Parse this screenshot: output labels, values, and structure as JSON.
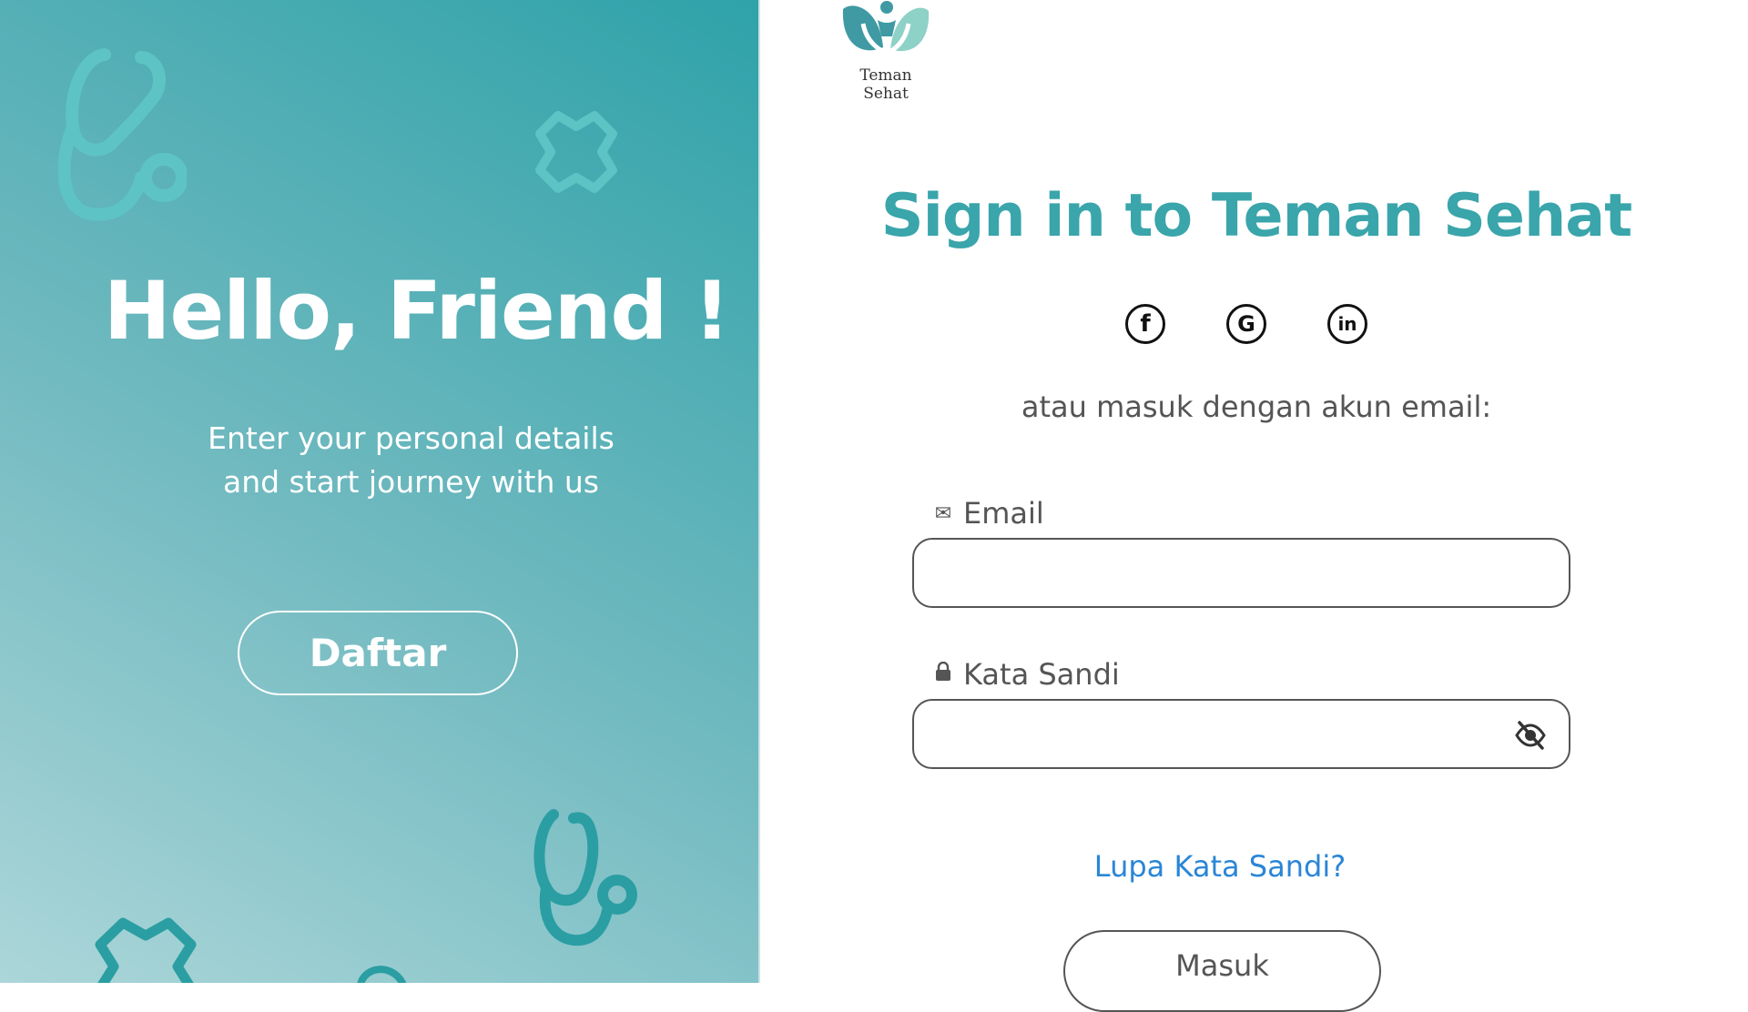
{
  "brand": {
    "name": "Teman Sehat"
  },
  "left_panel": {
    "title": "Hello, Friend !",
    "subtitle_line1": "Enter your personal details",
    "subtitle_line2": "and start journey with us",
    "register_button": "Daftar"
  },
  "right_panel": {
    "title": "Sign in to Teman Sehat",
    "social": [
      {
        "name": "facebook-icon",
        "glyph": "f"
      },
      {
        "name": "google-icon",
        "glyph": "G"
      },
      {
        "name": "linkedin-icon",
        "glyph": "in"
      }
    ],
    "or_text": "atau masuk dengan akun email:",
    "email": {
      "label": "Email",
      "value": "",
      "placeholder": ""
    },
    "password": {
      "label": "Kata Sandi",
      "value": "",
      "placeholder": ""
    },
    "forgot_link": "Lupa Kata Sandi?",
    "login_button": "Masuk"
  },
  "colors": {
    "brand_teal": "#3aa5ab",
    "link_blue": "#2a86d6",
    "gradient_dark": "#2fa2a9",
    "gradient_light": "#acd6d9"
  }
}
